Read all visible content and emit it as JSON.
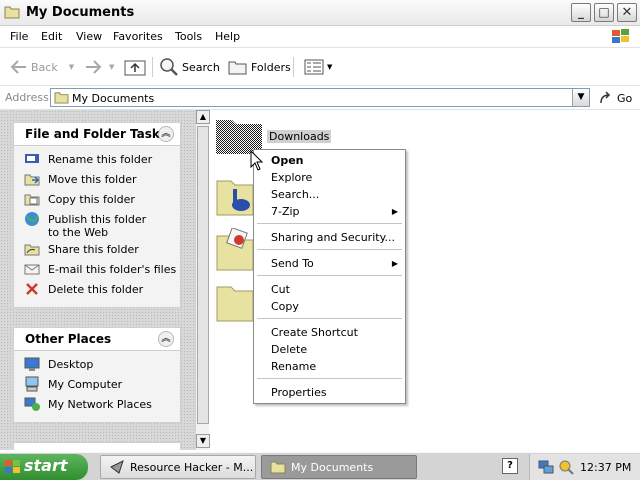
{
  "window": {
    "title": "My Documents",
    "buttons": {
      "minimize": "_",
      "maximize": "□",
      "close": "✕"
    }
  },
  "menubar": {
    "items": [
      "File",
      "Edit",
      "View",
      "Favorites",
      "Tools",
      "Help"
    ]
  },
  "toolbar": {
    "back_label": "Back",
    "search_label": "Search",
    "folders_label": "Folders"
  },
  "address": {
    "label": "Address",
    "value": "My Documents",
    "go_label": "Go"
  },
  "tasks": {
    "title": "File and Folder Tasks",
    "items": [
      "Rename this folder",
      "Move this folder",
      "Copy this folder",
      "Publish this folder to the Web",
      "Share this folder",
      "E-mail this folder's files",
      "Delete this folder"
    ]
  },
  "other_places": {
    "title": "Other Places",
    "items": [
      "Desktop",
      "My Computer",
      "My Network Places"
    ]
  },
  "files": {
    "selected_name": "Downloads"
  },
  "context_menu": {
    "open": "Open",
    "explore": "Explore",
    "search": "Search...",
    "zip": "7-Zip",
    "sharing": "Sharing and Security...",
    "send_to": "Send To",
    "cut": "Cut",
    "copy": "Copy",
    "create_shortcut": "Create Shortcut",
    "delete": "Delete",
    "rename": "Rename",
    "properties": "Properties"
  },
  "taskbar": {
    "start_label": "start",
    "buttons": [
      "Resource Hacker - M...",
      "My Documents"
    ],
    "clock": "12:37 PM"
  },
  "colors": {
    "folder": "#e8e2a0",
    "start": "#3a9a3a",
    "selection": "#d0d0d0"
  }
}
